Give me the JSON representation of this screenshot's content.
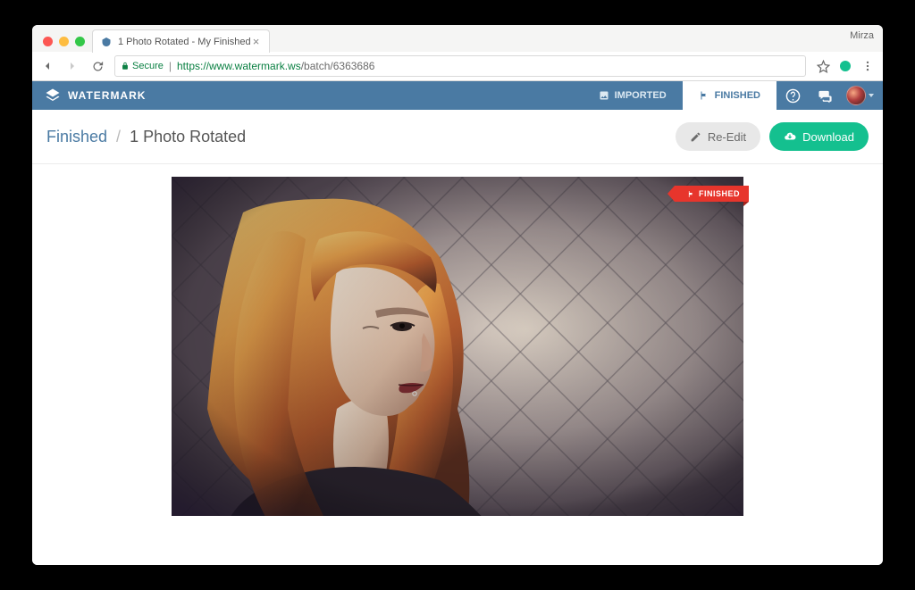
{
  "browser": {
    "profile_name": "Mirza",
    "tab": {
      "title": "1 Photo Rotated - My Finished"
    },
    "url": {
      "secure_label": "Secure",
      "protocol": "https://",
      "host": "www.watermark.ws",
      "path": "/batch/6363686"
    }
  },
  "header": {
    "brand": "WATERMARK",
    "tabs": {
      "imported": "IMPORTED",
      "finished": "FINISHED"
    }
  },
  "page": {
    "breadcrumb": {
      "root": "Finished",
      "sep": "/",
      "current": "1 Photo Rotated"
    },
    "actions": {
      "reedit": "Re-Edit",
      "download": "Download"
    }
  },
  "photo": {
    "ribbon_label": "FINISHED"
  },
  "colors": {
    "brand_blue": "#4a7aa3",
    "accent_green": "#14c08f",
    "ribbon_red": "#e7352c"
  }
}
